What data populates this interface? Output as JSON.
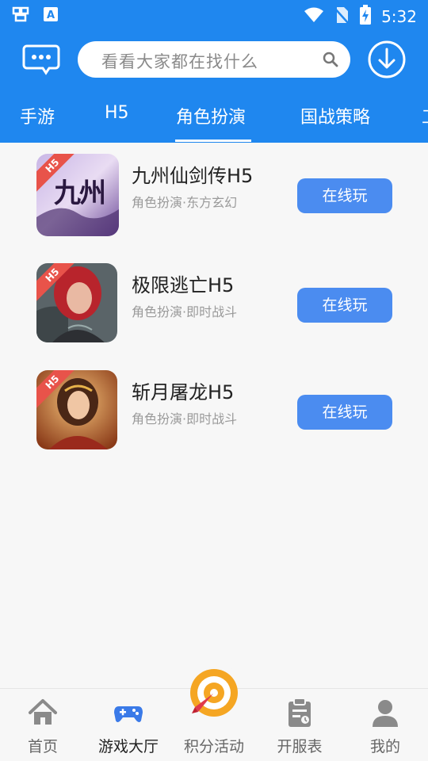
{
  "status_bar": {
    "time": "5:32",
    "left_icons": [
      "app-notification-icon",
      "text-a-icon"
    ],
    "right_icons": [
      "wifi-icon",
      "no-sim-icon",
      "battery-charging-icon"
    ]
  },
  "search": {
    "placeholder": "看看大家都在找什么"
  },
  "tabs": [
    {
      "label": "手游",
      "active": false
    },
    {
      "label": "H5",
      "active": false
    },
    {
      "label": "角色扮演",
      "active": true
    },
    {
      "label": "国战策略",
      "active": false
    },
    {
      "label": "工",
      "active": false
    }
  ],
  "games": [
    {
      "title": "九州仙剑传H5",
      "tags": "角色扮演·东方玄幻",
      "button": "在线玩",
      "badge": "H5",
      "thumb_text": "九州"
    },
    {
      "title": "极限逃亡H5",
      "tags": "角色扮演·即时战斗",
      "button": "在线玩",
      "badge": "H5"
    },
    {
      "title": "斩月屠龙H5",
      "tags": "角色扮演·即时战斗",
      "button": "在线玩",
      "badge": "H5"
    }
  ],
  "bottom_nav": [
    {
      "label": "首页",
      "icon": "home-icon",
      "active": false
    },
    {
      "label": "游戏大厅",
      "icon": "gamepad-icon",
      "active": true
    },
    {
      "label": "积分活动",
      "icon": "target-icon",
      "active": false
    },
    {
      "label": "开服表",
      "icon": "clipboard-icon",
      "active": false
    },
    {
      "label": "我的",
      "icon": "user-icon",
      "active": false
    }
  ],
  "colors": {
    "primary": "#1f87ef",
    "button": "#4b8cf0",
    "badge": "#e8534a",
    "accent_orange": "#f5a623",
    "nav_active_icon": "#3a7ae8"
  }
}
